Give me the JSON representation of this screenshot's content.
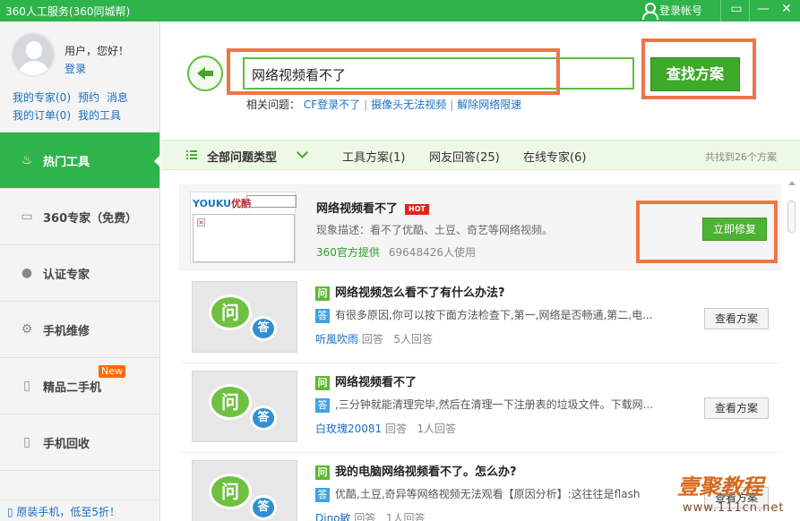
{
  "titlebar": {
    "title": "360人工服务(360同城帮)",
    "login": "登录帐号",
    "menu_icon": "▭",
    "minimize": "—",
    "close": "✕"
  },
  "profile": {
    "greeting": "用户，您好！",
    "login": "登录",
    "links_row1": [
      "我的专家(0)",
      "预约",
      "消息"
    ],
    "links_row2": [
      "我的订单(0)",
      "我的工具"
    ]
  },
  "nav": [
    {
      "label": "热门工具",
      "icon": "fire-icon",
      "active": true
    },
    {
      "label": "360专家（免费）",
      "icon": "monitor-icon"
    },
    {
      "label": "认证专家",
      "icon": "person-icon"
    },
    {
      "label": "手机维修",
      "icon": "wrench-icon"
    },
    {
      "label": "精品二手机",
      "icon": "phone-icon",
      "badge": "New"
    },
    {
      "label": "手机回收",
      "icon": "recycle-phone-icon"
    }
  ],
  "promo": "原装手机，低至5折！",
  "search": {
    "value": "网络视频看不了",
    "button": "查找方案"
  },
  "related": {
    "label": "相关问题：",
    "items": [
      "CF登录不了",
      "摄像头无法视频",
      "解除网络限速"
    ]
  },
  "filter": {
    "all": "全部问题类型",
    "tabs": [
      "工具方案(1)",
      "网友回答(25)",
      "在线专家(6)"
    ],
    "found": "共找到26个方案"
  },
  "tool_result": {
    "thumb_logo_a": "YOUKU",
    "thumb_logo_b": "优酷",
    "title": "网络视频看不了",
    "hot": "HOT",
    "desc": "现象描述：看不了优酷、土豆、奇艺等网络视频。",
    "source": "360官方提供",
    "users": "69648426人使用",
    "button": "立即修复"
  },
  "qa_results": [
    {
      "q": "网络视频怎么看不了有什么办法?",
      "a": "有很多原因,你可以按下面方法检查下,第一,网络是否畅通,第二,电...",
      "user": "听風吹雨",
      "answer_label": "回答",
      "count": "5人回答",
      "button": "查看方案"
    },
    {
      "q": "网络视频看不了",
      "a": ",三分钟就能清理完毕,然后在清理一下注册表的垃圾文件。下载网...",
      "user": "白玫瑰20081",
      "answer_label": "回答",
      "count": "1人回答",
      "button": "查看方案"
    },
    {
      "q": "我的电脑网络视频看不了。怎么办?",
      "a": "优酷,土豆,奇异等网络视频无法观看【原因分析】:这往往是flash",
      "user": "Dino敏",
      "answer_label": "回答",
      "count": "1人回答",
      "button": "查看方案"
    }
  ],
  "qa_badges": {
    "question": "问",
    "answer": "答",
    "icon_q": "问",
    "icon_a": "答"
  },
  "watermark": {
    "main": "壹聚教程",
    "url": "www.111cn.net"
  }
}
